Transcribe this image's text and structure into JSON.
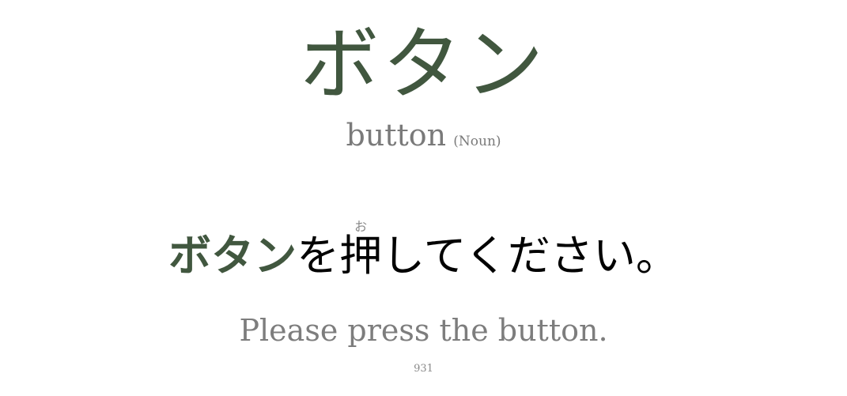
{
  "card": {
    "word": "ボタン",
    "gloss": "button",
    "part_of_speech": "(Noun)",
    "sentence": {
      "target": "ボタン",
      "particle": "を",
      "kanji": "押",
      "kanji_reading": "お",
      "rest": "してください。"
    },
    "translation": "Please press the button.",
    "number": "931"
  },
  "colors": {
    "accent": "#41573f",
    "muted": "#7a7a7a",
    "text": "#000000",
    "background": "#ffffff"
  }
}
